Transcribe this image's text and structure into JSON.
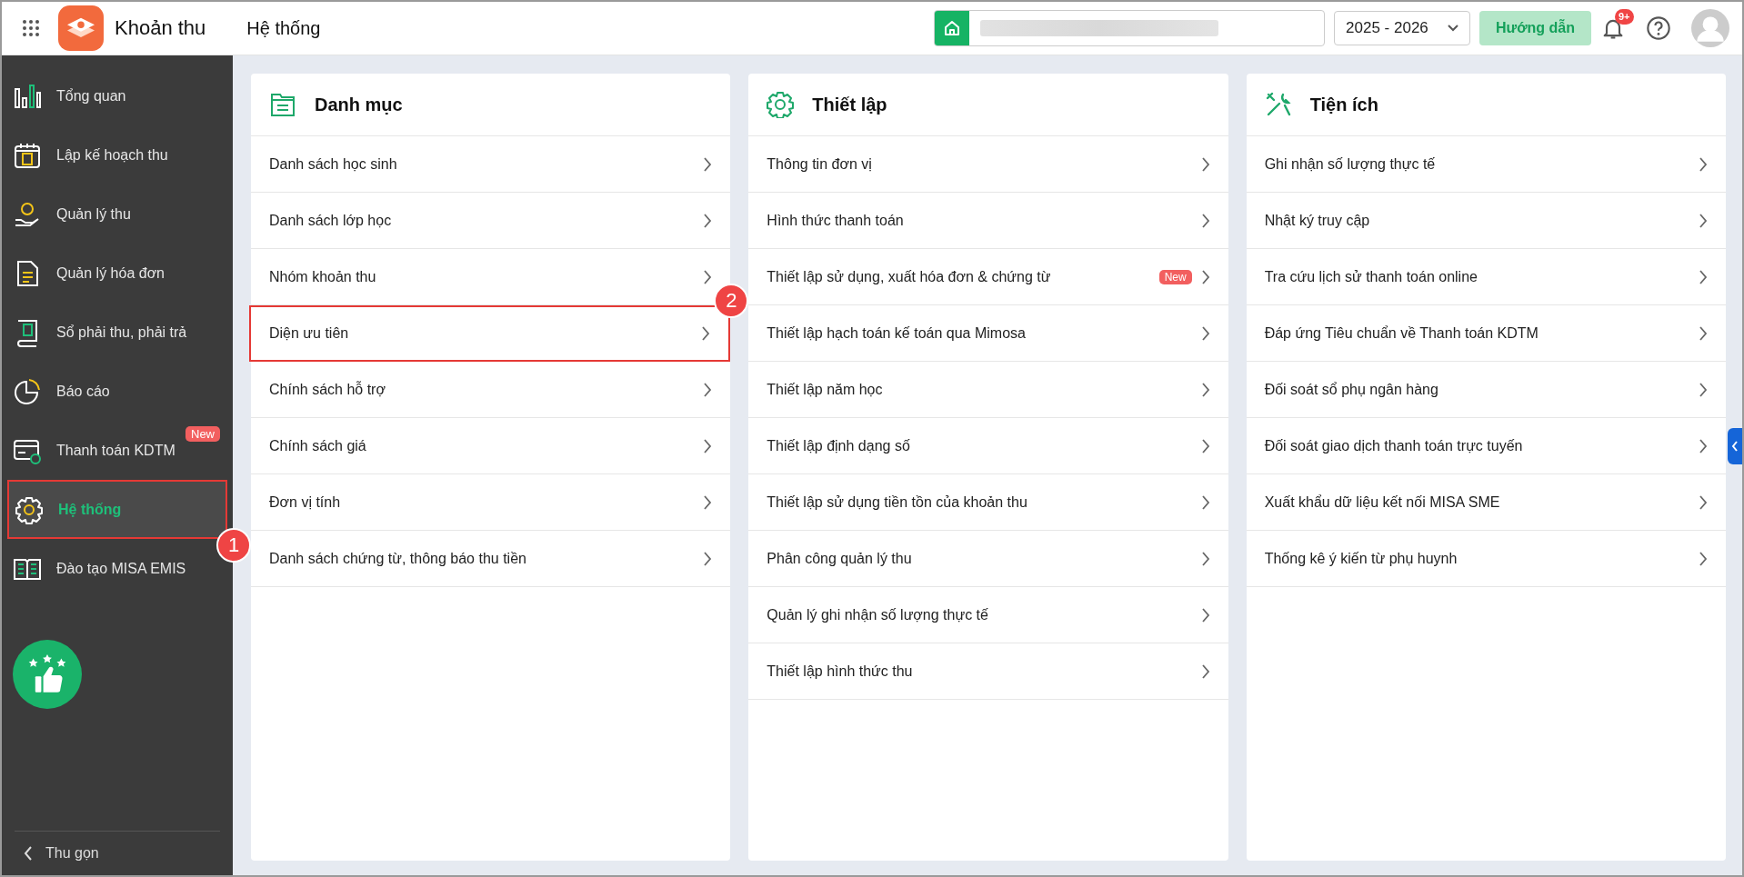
{
  "app": {
    "name": "Khoản thu"
  },
  "page_title": "Hệ thống",
  "year_select": {
    "value": "2025 - 2026"
  },
  "guide_button": "Hướng dẫn",
  "notifications": {
    "badge": "9+"
  },
  "sidebar": {
    "items": [
      {
        "label": "Tổng quan",
        "kind": "chart",
        "selected": false,
        "highlighted": false
      },
      {
        "label": "Lập kế hoạch thu",
        "kind": "calendar",
        "selected": false,
        "highlighted": false
      },
      {
        "label": "Quản lý thu",
        "kind": "coin-hand",
        "selected": false,
        "highlighted": false
      },
      {
        "label": "Quản lý hóa đơn",
        "kind": "document",
        "selected": false,
        "highlighted": false
      },
      {
        "label": "Sổ phải thu, phải trả",
        "kind": "ledger",
        "selected": false,
        "highlighted": false
      },
      {
        "label": "Báo cáo",
        "kind": "pie",
        "selected": false,
        "highlighted": false
      },
      {
        "label": "Thanh toán KDTM",
        "kind": "card",
        "selected": false,
        "highlighted": false,
        "badge": "New"
      },
      {
        "label": "Hệ thống",
        "kind": "gear",
        "selected": true,
        "highlighted": true,
        "callout": "1"
      },
      {
        "label": "Đào tạo MISA EMIS",
        "kind": "book",
        "selected": false,
        "highlighted": false
      }
    ],
    "collapse": "Thu gọn"
  },
  "cards": [
    {
      "title": "Danh mục",
      "kind": "folder",
      "items": [
        {
          "label": "Danh sách học sinh",
          "highlighted": false
        },
        {
          "label": "Danh sách lớp học",
          "highlighted": false
        },
        {
          "label": "Nhóm khoản thu",
          "highlighted": false
        },
        {
          "label": "Diện ưu tiên",
          "highlighted": true,
          "callout": "2"
        },
        {
          "label": "Chính sách hỗ trợ",
          "highlighted": false
        },
        {
          "label": "Chính sách giá",
          "highlighted": false
        },
        {
          "label": "Đơn vị tính",
          "highlighted": false
        },
        {
          "label": "Danh sách chứng từ, thông báo thu tiền",
          "highlighted": false
        }
      ]
    },
    {
      "title": "Thiết lập",
      "kind": "gear",
      "items": [
        {
          "label": "Thông tin đơn vị",
          "highlighted": false
        },
        {
          "label": "Hình thức thanh toán",
          "highlighted": false
        },
        {
          "label": "Thiết lập sử dụng, xuất hóa đơn & chứng từ",
          "highlighted": false,
          "badge": "New"
        },
        {
          "label": "Thiết lập hạch toán kế toán qua Mimosa",
          "highlighted": false
        },
        {
          "label": "Thiết lập năm học",
          "highlighted": false
        },
        {
          "label": "Thiết lập định dạng số",
          "highlighted": false
        },
        {
          "label": "Thiết lập sử dụng tiền tồn của khoản thu",
          "highlighted": false
        },
        {
          "label": "Phân công quản lý thu",
          "highlighted": false
        },
        {
          "label": "Quản lý ghi nhận số lượng thực tế",
          "highlighted": false
        },
        {
          "label": "Thiết lập hình thức thu",
          "highlighted": false
        }
      ]
    },
    {
      "title": "Tiện ích",
      "kind": "tools",
      "items": [
        {
          "label": "Ghi nhận số lượng thực tế",
          "highlighted": false
        },
        {
          "label": "Nhật ký truy cập",
          "highlighted": false
        },
        {
          "label": "Tra cứu lịch sử thanh toán online",
          "highlighted": false
        },
        {
          "label": "Đáp ứng Tiêu chuẩn về Thanh toán KDTM",
          "highlighted": false
        },
        {
          "label": "Đối soát sổ phụ ngân hàng",
          "highlighted": false
        },
        {
          "label": "Đối soát giao dịch thanh toán trực tuyến",
          "highlighted": false
        },
        {
          "label": "Xuất khẩu dữ liệu kết nối MISA SME",
          "highlighted": false
        },
        {
          "label": "Thống kê ý kiến từ phụ huynh",
          "highlighted": false
        }
      ]
    }
  ]
}
